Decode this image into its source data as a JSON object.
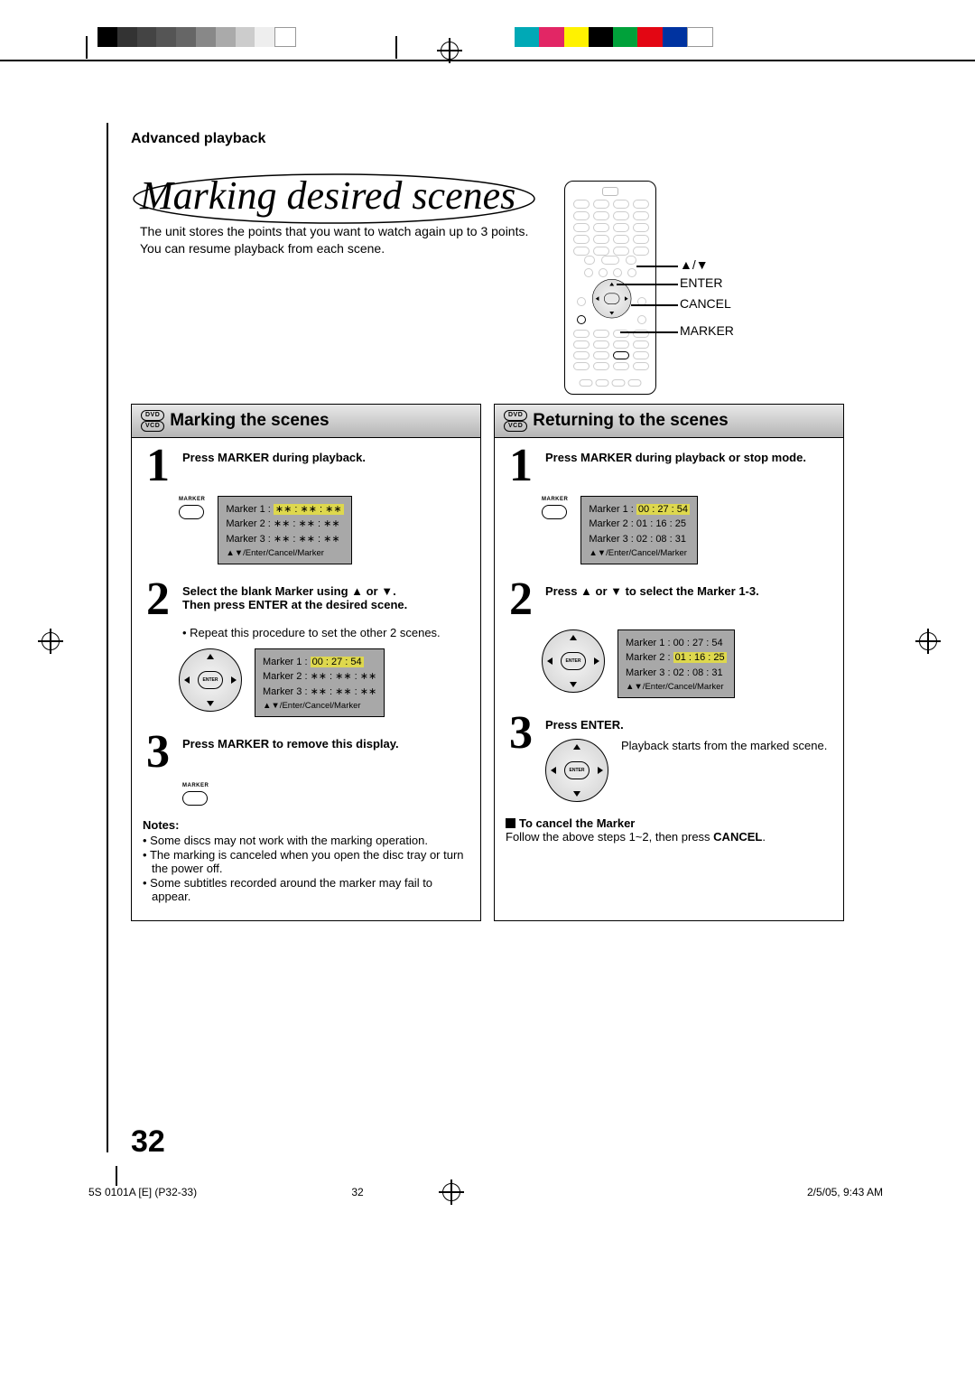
{
  "header": {
    "section": "Advanced playback",
    "title": "Marking desired scenes",
    "intro_l1": "The unit stores the points that you want to watch again up to 3 points.",
    "intro_l2": "You can resume playback from each scene."
  },
  "remote_callouts": {
    "nav": "▲/▼",
    "enter": "ENTER",
    "cancel": "CANCEL",
    "marker": "MARKER"
  },
  "badges": {
    "dvd": "DVD",
    "vcd": "VCD"
  },
  "left": {
    "heading": "Marking the scenes",
    "s1_title": "Press MARKER during playback.",
    "s1_button": "MARKER",
    "s2_l1": "Select the blank Marker using ▲ or ▼.",
    "s2_l2": "Then press ENTER at the desired scene.",
    "s2_note": "• Repeat this procedure to set the other 2 scenes.",
    "s3_title": "Press MARKER to remove this display.",
    "s3_button": "MARKER",
    "osd_hint": "▲▼/Enter/Cancel/Marker",
    "osd1": {
      "r1": "Marker    1 :   ",
      "r1_hl": "∗∗ : ∗∗ : ∗∗",
      "r2": "Marker    2 :   ∗∗ : ∗∗ : ∗∗",
      "r3": "Marker    3 :   ∗∗ : ∗∗ : ∗∗"
    },
    "osd2": {
      "r1": "Marker    1 :   ",
      "r1_hl": "00 : 27 : 54",
      "r2": "Marker    2 :   ∗∗ : ∗∗ : ∗∗",
      "r3": "Marker    3 :   ∗∗ : ∗∗ : ∗∗"
    },
    "notes_title": "Notes:",
    "notes": {
      "n1": "Some discs may not work with the marking operation.",
      "n2": "The marking is canceled when you open the disc tray or turn the power off.",
      "n3": "Some subtitles recorded around the marker may fail to appear."
    }
  },
  "right": {
    "heading": "Returning to the scenes",
    "s1_title": "Press MARKER during playback or stop mode.",
    "s1_button": "MARKER",
    "osd_hint": "▲▼/Enter/Cancel/Marker",
    "osd1": {
      "r1": "Marker    1 :   ",
      "r1_hl": "00 : 27 : 54",
      "r2": "Marker    2 :   01 : 16 : 25",
      "r3": "Marker    3 :   02 : 08 : 31"
    },
    "s2_title": "Press ▲ or ▼ to select the Marker 1-3.",
    "osd2": {
      "r1": "Marker    1 :   00 : 27 : 54",
      "r2": "Marker    2 :   ",
      "r2_hl": "01 : 16 : 25",
      "r3": "Marker    3 :   02 : 08 : 31"
    },
    "s3_title": "Press ENTER.",
    "s3_note": "Playback starts from the marked scene.",
    "cancel_head": "To cancel the Marker",
    "cancel_body_pre": "Follow the above steps 1~2, then press ",
    "cancel_body_strong": "CANCEL",
    "cancel_body_post": "."
  },
  "page_number": "32",
  "footer": {
    "doc": "5S 0101A [E] (P32-33)",
    "pg": "32",
    "date": "2/5/05, 9:43 AM"
  }
}
